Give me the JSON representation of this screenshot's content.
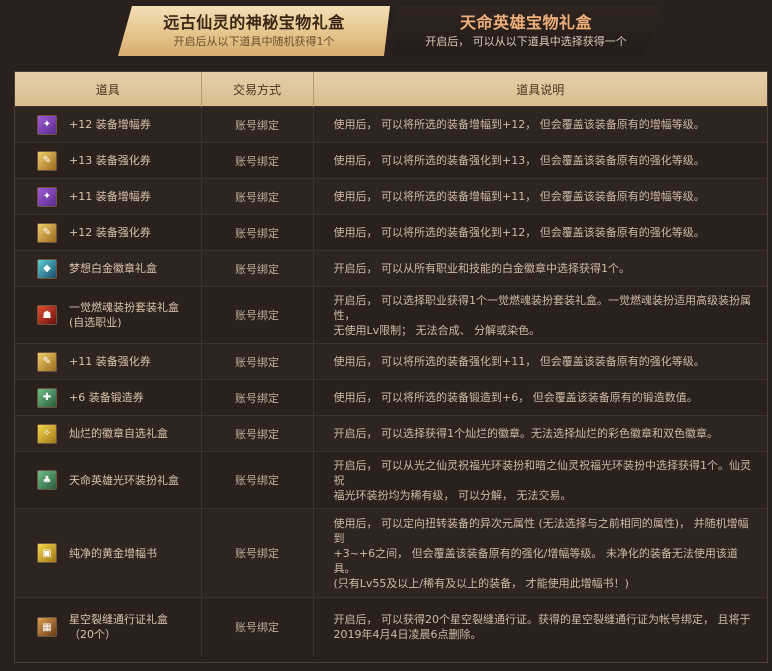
{
  "tabs": {
    "a": {
      "title": "远古仙灵的神秘宝物礼盒",
      "subtitle": "开启后从以下道具中随机获得1个"
    },
    "b": {
      "title": "天命英雄宝物礼盒",
      "subtitle": "开启后， 可以从以下道具中选择获得一个"
    }
  },
  "table": {
    "headers": [
      "道具",
      "交易方式",
      "道具说明"
    ],
    "rows": [
      {
        "icon": "amplify-scroll-icon",
        "name": "+12 装备增幅券",
        "trade": "账号绑定",
        "desc": "使用后， 可以将所选的装备增幅到+12， 但会覆盖该装备原有的增幅等级。"
      },
      {
        "icon": "reinforce-scroll-icon",
        "name": "+13 装备强化券",
        "trade": "账号绑定",
        "desc": "使用后， 可以将所选的装备强化到+13， 但会覆盖该装备原有的强化等级。"
      },
      {
        "icon": "amplify-scroll-icon",
        "name": "+11 装备增幅券",
        "trade": "账号绑定",
        "desc": "使用后， 可以将所选的装备增幅到+11， 但会覆盖该装备原有的增幅等级。"
      },
      {
        "icon": "reinforce-scroll-icon",
        "name": "+12 装备强化券",
        "trade": "账号绑定",
        "desc": "使用后， 可以将所选的装备强化到+12， 但会覆盖该装备原有的强化等级。"
      },
      {
        "icon": "platinum-emblem-icon",
        "name": "梦想白金徽章礼盒",
        "trade": "账号绑定",
        "desc": "开启后， 可以从所有职业和技能的白金徽章中选择获得1个。"
      },
      {
        "icon": "avatar-box-icon",
        "name": "一觉燃魂装扮套装礼盒\n(自选职业)",
        "trade": "账号绑定",
        "desc": "开启后， 可以选择职业获得1个一觉燃魂装扮套装礼盒。一觉燃魂装扮适用高级装扮属性，\n无使用Lv限制； 无法合成、 分解或染色。"
      },
      {
        "icon": "reinforce-scroll-icon",
        "name": "+11 装备强化券",
        "trade": "账号绑定",
        "desc": "使用后， 可以将所选的装备强化到+11， 但会覆盖该装备原有的强化等级。"
      },
      {
        "icon": "refine-scroll-icon",
        "name": "+6 装备锻造券",
        "trade": "账号绑定",
        "desc": "使用后， 可以将所选的装备锻造到+6， 但会覆盖该装备原有的锻造数值。"
      },
      {
        "icon": "brilliant-emblem-icon",
        "name": "灿烂的徽章自选礼盒",
        "trade": "账号绑定",
        "desc": "开启后， 可以选择获得1个灿烂的徽章。无法选择灿烂的彩色徽章和双色徽章。"
      },
      {
        "icon": "aura-box-icon",
        "name": "天命英雄光环装扮礼盒",
        "trade": "账号绑定",
        "desc": "开启后， 可以从光之仙灵祝福光环装扮和暗之仙灵祝福光环装扮中选择获得1个。仙灵祝\n福光环装扮均为稀有级， 可以分解， 无法交易。"
      },
      {
        "icon": "golden-book-icon",
        "name": "纯净的黄金增幅书",
        "trade": "账号绑定",
        "desc": "使用后， 可以定向扭转装备的异次元属性 (无法选择与之前相同的属性)， 并随机增幅到\n+3~+6之间， 但会覆盖该装备原有的强化/增幅等级。 未净化的装备无法使用该道具。\n(只有Lv55及以上/稀有及以上的装备， 才能使用此增幅书！)"
      },
      {
        "icon": "pass-box-icon",
        "name": "星空裂缝通行证礼盒\n（20个）",
        "trade": "账号绑定",
        "desc": "开启后， 可以获得20个星空裂缝通行证。获得的星空裂缝通行证为帐号绑定， 且将于\n2019年4月4日凌晨6点删除。"
      }
    ]
  }
}
